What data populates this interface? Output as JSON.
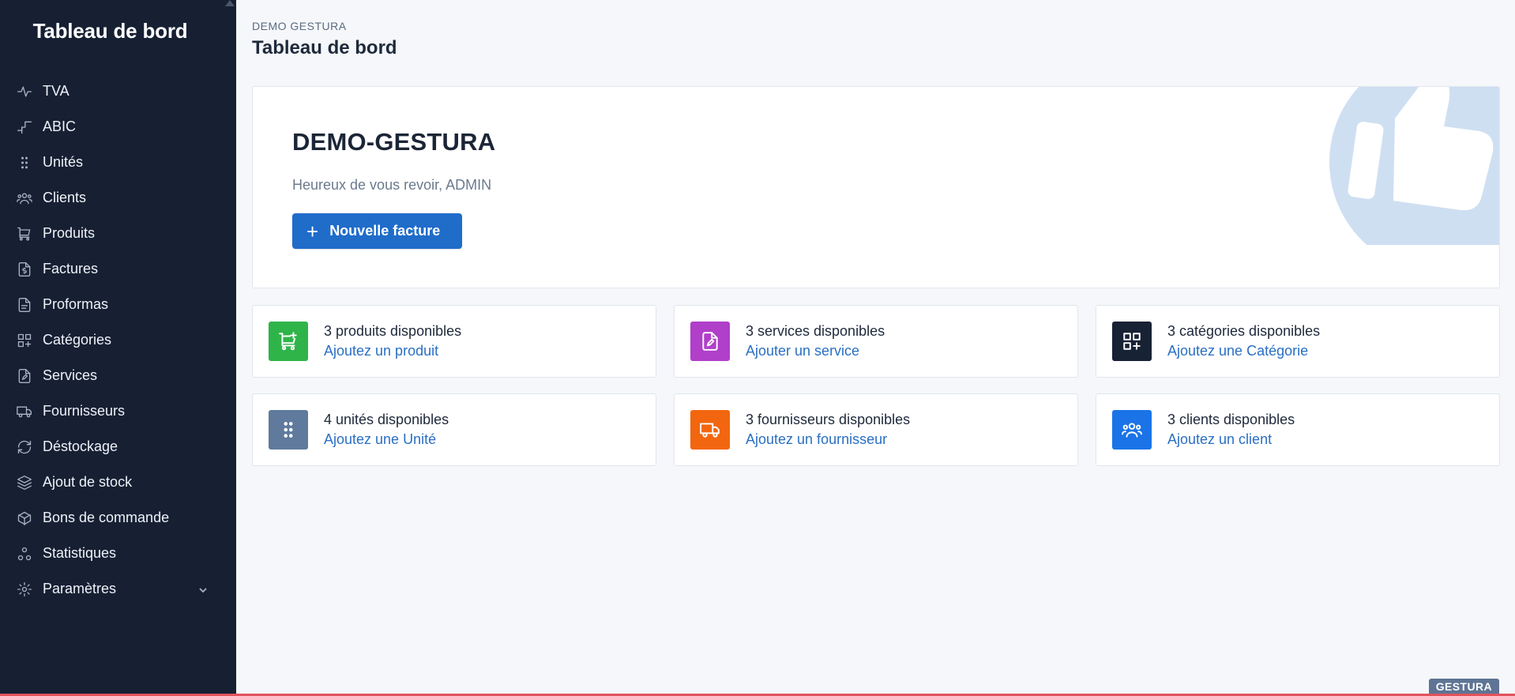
{
  "sidebar": {
    "title": "Tableau de bord",
    "items": [
      {
        "label": "TVA",
        "icon": "activity-icon"
      },
      {
        "label": "ABIC",
        "icon": "step-chart-icon"
      },
      {
        "label": "Unités",
        "icon": "grip-dots-icon"
      },
      {
        "label": "Clients",
        "icon": "users-icon"
      },
      {
        "label": "Produits",
        "icon": "cart-icon"
      },
      {
        "label": "Factures",
        "icon": "invoice-icon"
      },
      {
        "label": "Proformas",
        "icon": "document-icon"
      },
      {
        "label": "Catégories",
        "icon": "grid-plus-icon"
      },
      {
        "label": "Services",
        "icon": "file-edit-icon"
      },
      {
        "label": "Fournisseurs",
        "icon": "truck-icon"
      },
      {
        "label": "Déstockage",
        "icon": "refresh-icon"
      },
      {
        "label": "Ajout de stock",
        "icon": "layers-icon"
      },
      {
        "label": "Bons de commande",
        "icon": "package-icon"
      },
      {
        "label": "Statistiques",
        "icon": "nodes-icon"
      },
      {
        "label": "Paramètres",
        "icon": "gear-icon"
      }
    ]
  },
  "header": {
    "breadcrumb": "DEMO GESTURA",
    "title": "Tableau de bord"
  },
  "hero": {
    "company": "DEMO-GESTURA",
    "greeting": "Heureux de vous revoir, ADMIN",
    "button_label": "Nouvelle facture"
  },
  "cards": [
    {
      "count_text": "3 produits disponibles",
      "link_text": "Ajoutez un produit",
      "color": "#2fb44a",
      "icon": "cart-plus-icon"
    },
    {
      "count_text": "3 services disponibles",
      "link_text": "Ajouter un service",
      "color": "#b03fc9",
      "icon": "file-edit-icon"
    },
    {
      "count_text": "3 catégories disponibles",
      "link_text": "Ajoutez une Catégorie",
      "color": "#182235",
      "icon": "grid-plus-icon"
    },
    {
      "count_text": "4 unités disponibles",
      "link_text": "Ajoutez une Unité",
      "color": "#5f7a9c",
      "icon": "grip-dots-icon"
    },
    {
      "count_text": "3 fournisseurs disponibles",
      "link_text": "Ajoutez un fournisseur",
      "color": "#f2660f",
      "icon": "truck-icon"
    },
    {
      "count_text": "3 clients disponibles",
      "link_text": "Ajoutez un client",
      "color": "#1a74e8",
      "icon": "users-icon"
    }
  ],
  "footer": {
    "brand": "GESTURA"
  },
  "colors": {
    "sidebar_bg": "#172033",
    "primary": "#1f6cc9",
    "link": "#2a6fc4",
    "bottom_line": "#e2525b"
  }
}
